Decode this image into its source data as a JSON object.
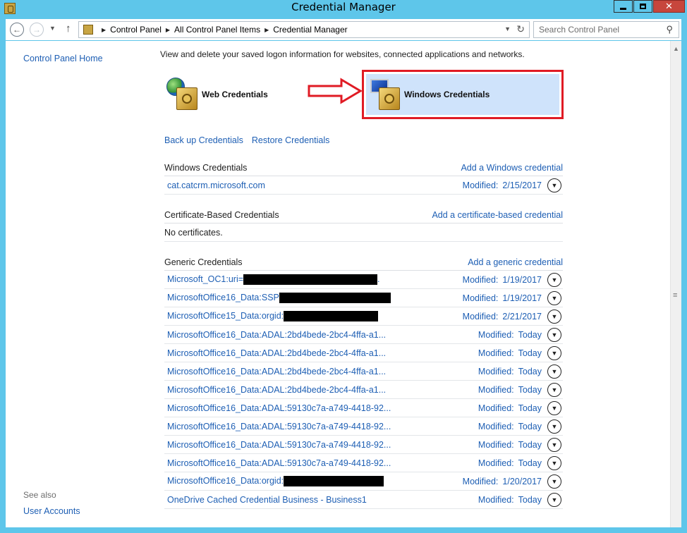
{
  "window": {
    "title": "Credential Manager"
  },
  "address_bar": {
    "crumbs": [
      "Control Panel",
      "All Control Panel Items",
      "Credential Manager"
    ]
  },
  "search": {
    "placeholder": "Search Control Panel"
  },
  "left_pane": {
    "home_link": "Control Panel Home",
    "see_also": "See also",
    "user_accounts": "User Accounts"
  },
  "main": {
    "intro": "View and delete your saved logon information for websites, connected applications and networks.",
    "web_credentials": "Web Credentials",
    "windows_credentials": "Windows Credentials",
    "backup_link": "Back up Credentials",
    "restore_link": "Restore Credentials"
  },
  "windows_section": {
    "title": "Windows Credentials",
    "add_link": "Add a Windows credential",
    "items": [
      {
        "name": "cat.catcrm.microsoft.com",
        "modified_label": "Modified:",
        "modified": "2/15/2017"
      }
    ]
  },
  "cert_section": {
    "title": "Certificate-Based Credentials",
    "add_link": "Add a certificate-based credential",
    "empty": "No certificates."
  },
  "generic_section": {
    "title": "Generic Credentials",
    "add_link": "Add a generic credential",
    "items": [
      {
        "name": "Microsoft_OC1:uri=",
        "modified_label": "Modified:",
        "modified": "1/19/2017"
      },
      {
        "name": "MicrosoftOffice16_Data:SSP",
        "modified_label": "Modified:",
        "modified": "1/19/2017"
      },
      {
        "name": "MicrosoftOffice15_Data:orgid:",
        "modified_label": "Modified:",
        "modified": "2/21/2017"
      },
      {
        "name": "MicrosoftOffice16_Data:ADAL:2bd4bede-2bc4-4ffa-a1...",
        "modified_label": "Modified:",
        "modified": "Today"
      },
      {
        "name": "MicrosoftOffice16_Data:ADAL:2bd4bede-2bc4-4ffa-a1...",
        "modified_label": "Modified:",
        "modified": "Today"
      },
      {
        "name": "MicrosoftOffice16_Data:ADAL:2bd4bede-2bc4-4ffa-a1...",
        "modified_label": "Modified:",
        "modified": "Today"
      },
      {
        "name": "MicrosoftOffice16_Data:ADAL:2bd4bede-2bc4-4ffa-a1...",
        "modified_label": "Modified:",
        "modified": "Today"
      },
      {
        "name": "MicrosoftOffice16_Data:ADAL:59130c7a-a749-4418-92...",
        "modified_label": "Modified:",
        "modified": "Today"
      },
      {
        "name": "MicrosoftOffice16_Data:ADAL:59130c7a-a749-4418-92...",
        "modified_label": "Modified:",
        "modified": "Today"
      },
      {
        "name": "MicrosoftOffice16_Data:ADAL:59130c7a-a749-4418-92...",
        "modified_label": "Modified:",
        "modified": "Today"
      },
      {
        "name": "MicrosoftOffice16_Data:ADAL:59130c7a-a749-4418-92...",
        "modified_label": "Modified:",
        "modified": "Today"
      },
      {
        "name": "MicrosoftOffice16_Data:orgid:",
        "modified_label": "Modified:",
        "modified": "1/20/2017"
      },
      {
        "name": "OneDrive Cached Credential Business - Business1",
        "modified_label": "Modified:",
        "modified": "Today"
      }
    ]
  },
  "colors": {
    "frame": "#5ec6ea",
    "link": "#1e5fb4",
    "highlight": "#cfe3fb",
    "annotation": "#e01b24"
  }
}
